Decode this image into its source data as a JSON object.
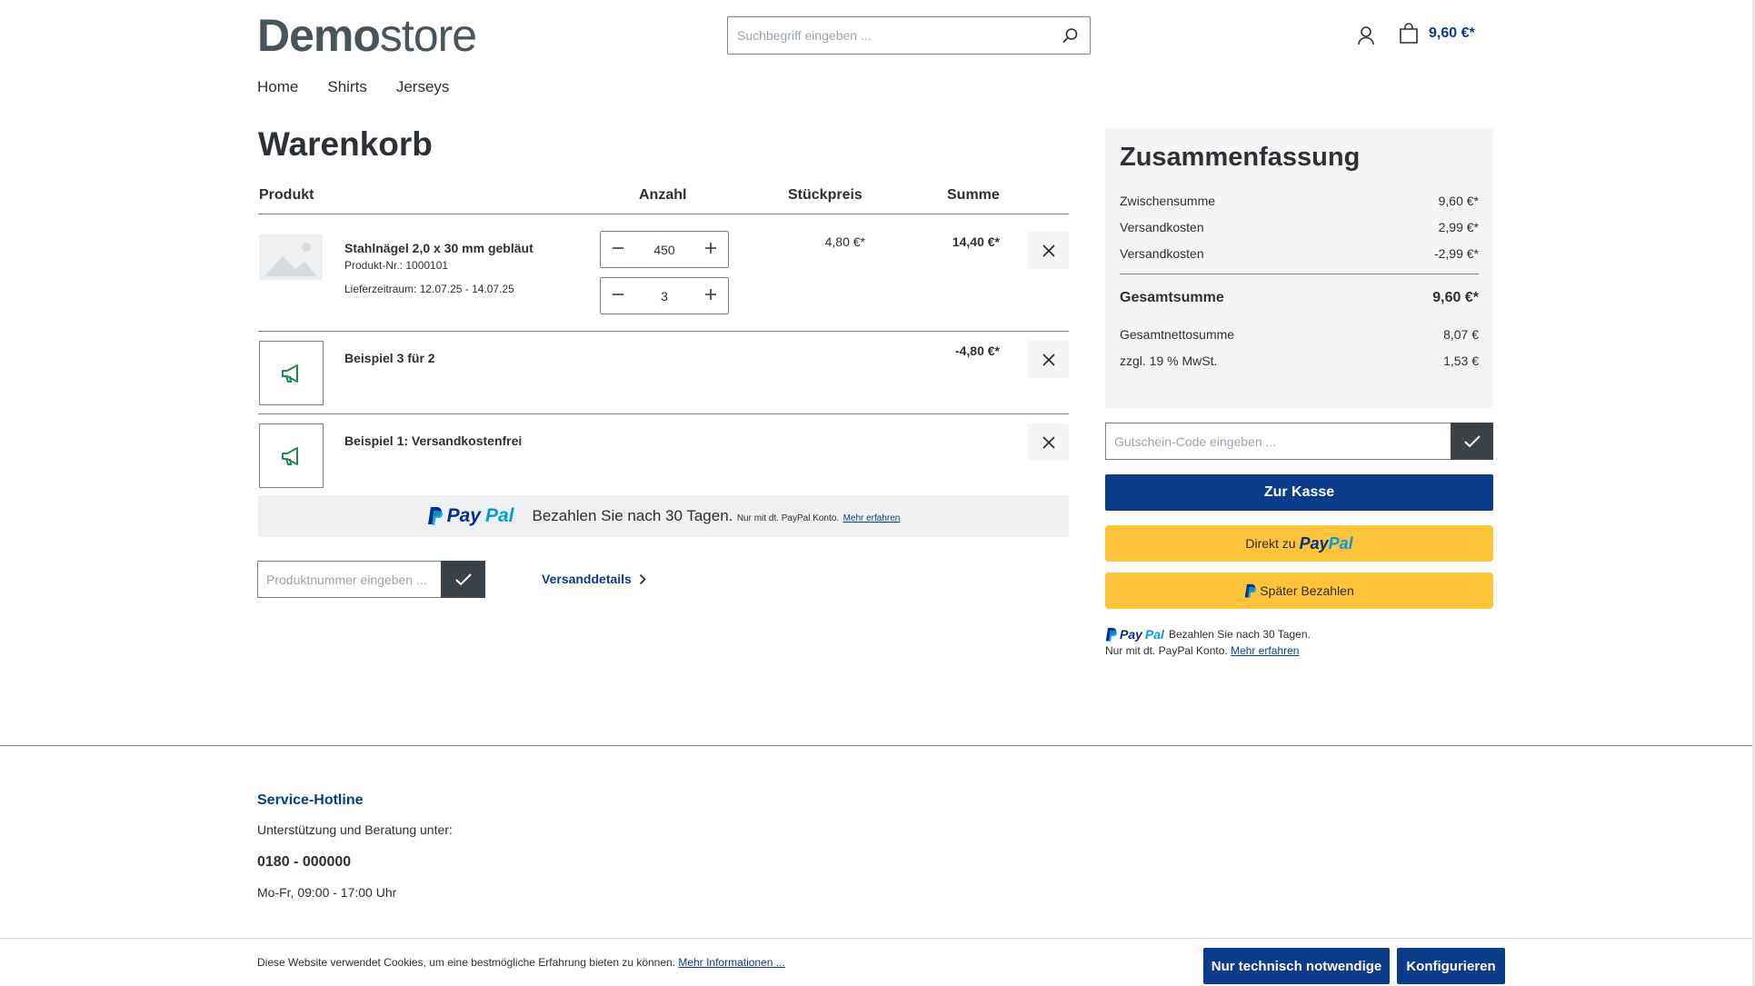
{
  "header": {
    "logo_bold": "Demo",
    "logo_light": "store",
    "search_placeholder": "Suchbegriff eingeben ...",
    "cart_total": "9,60 €*"
  },
  "nav": {
    "items": [
      "Home",
      "Shirts",
      "Jerseys"
    ]
  },
  "cart": {
    "title": "Warenkorb",
    "columns": {
      "product": "Produkt",
      "quantity": "Anzahl",
      "unit_price": "Stückpreis",
      "total": "Summe"
    },
    "line_items": [
      {
        "name": "Stahlnägel 2,0 x 30 mm gebläut",
        "number": "Produkt-Nr.: 1000101",
        "delivery": "Lieferzeitraum: 12.07.25 - 14.07.25",
        "quantities": [
          "450",
          "3"
        ],
        "unit_price": "4,80 €*",
        "total": "14,40 €*"
      }
    ],
    "promotions": [
      {
        "name": "Beispiel 3 für 2",
        "total": "-4,80 €*"
      },
      {
        "name": "Beispiel 1: Versandkostenfrei",
        "total": ""
      }
    ],
    "paypal_banner": {
      "logo_pay": "Pay",
      "logo_pal": "Pal",
      "text": "Bezahlen Sie nach 30 Tagen.",
      "small": "Nur mit dt. PayPal Konto.",
      "link": "Mehr erfahren"
    },
    "product_number_placeholder": "Produktnummer eingeben ...",
    "shipping_details": "Versanddetails"
  },
  "summary": {
    "title": "Zusammenfassung",
    "rows": [
      {
        "label": "Zwischensumme",
        "value": "9,60 €*"
      },
      {
        "label": "Versandkosten",
        "value": "2,99 €*"
      },
      {
        "label": "Versandkosten",
        "value": "-2,99 €*"
      }
    ],
    "total": {
      "label": "Gesamtsumme",
      "value": "9,60 €*"
    },
    "net_rows": [
      {
        "label": "Gesamtnettosumme",
        "value": "8,07 €"
      },
      {
        "label": "zzgl. 19 % MwSt.",
        "value": "1,53 €"
      }
    ],
    "voucher_placeholder": "Gutschein-Code eingeben ...",
    "checkout": "Zur Kasse",
    "paypal_direct_prefix": "Direkt zu",
    "paypal_later": "Später Bezahlen",
    "paypal_msg_line1": "Bezahlen Sie nach 30 Tagen.",
    "paypal_msg_line2": "Nur mit dt. PayPal Konto.",
    "paypal_msg_link": "Mehr erfahren"
  },
  "footer": {
    "hotline_title": "Service-Hotline",
    "hotline_text": "Unterstützung und Beratung unter:",
    "phone": "0180 - 000000",
    "hours": "Mo-Fr, 09:00 - 17:00 Uhr"
  },
  "cookie": {
    "text": "Diese Website verwendet Cookies, um eine bestmögliche Erfahrung bieten zu können.",
    "link": "Mehr Informationen ...",
    "btn_necessary": "Nur technisch notwendige",
    "btn_configure": "Konfigurieren"
  },
  "colors": {
    "primary": "#0b3c8c",
    "paypal_yellow": "#ffc439",
    "text": "#2b3136"
  }
}
